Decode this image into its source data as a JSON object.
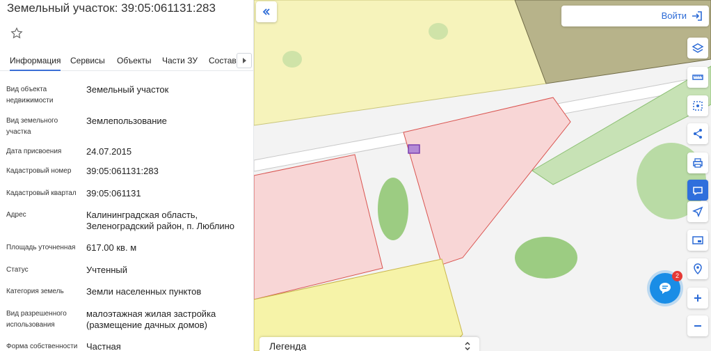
{
  "panel": {
    "title": "Земельный участок: 39:05:061131:283",
    "favorite_icon": "star-outline-icon"
  },
  "tabs": [
    {
      "label": "Информация",
      "active": true
    },
    {
      "label": "Сервисы",
      "active": false
    },
    {
      "label": "Объекты",
      "active": false
    },
    {
      "label": "Части ЗУ",
      "active": false
    },
    {
      "label": "Состав",
      "active": false
    }
  ],
  "attributes": [
    {
      "label": "Вид объекта недвижимости",
      "value": "Земельный участок"
    },
    {
      "label": "Вид земельного участка",
      "value": "Землепользование"
    },
    {
      "label": "Дата присвоения",
      "value": "24.07.2015"
    },
    {
      "label": "Кадастровый номер",
      "value": "39:05:061131:283"
    },
    {
      "label": "Кадастровый квартал",
      "value": "39:05:061131"
    },
    {
      "label": "Адрес",
      "value": "Калининградская область, Зеленоградский район, п. Люблино"
    },
    {
      "label": "Площадь уточненная",
      "value": "617.00 кв. м"
    },
    {
      "label": "Статус",
      "value": "Учтенный"
    },
    {
      "label": "Категория земель",
      "value": "Земли населенных пунктов"
    },
    {
      "label": "Вид разрешенного использования",
      "value": "малоэтажная жилая застройка (размещение дачных домов)"
    },
    {
      "label": "Форма собственности",
      "value": "Частная"
    }
  ],
  "header": {
    "login_label": "Войти"
  },
  "map_tools": [
    {
      "name": "layers-icon"
    },
    {
      "name": "ruler-icon"
    },
    {
      "name": "select-area-icon"
    },
    {
      "name": "share-icon"
    },
    {
      "name": "print-icon"
    },
    {
      "name": "map-info-icon"
    },
    {
      "name": "navigate-icon"
    },
    {
      "name": "minimap-icon"
    },
    {
      "name": "location-pin-icon"
    },
    {
      "name": "zoom-in-icon"
    },
    {
      "name": "zoom-out-icon"
    }
  ],
  "chat": {
    "badge": "2"
  },
  "legend": {
    "label": "Легенда"
  },
  "colors": {
    "accent": "#2f6fdc",
    "parcel_fill": "#f8d9d9",
    "parcel_stroke": "#d9534f",
    "zone_yellow": "#f5f2b8",
    "forest": "#9ccc82"
  }
}
